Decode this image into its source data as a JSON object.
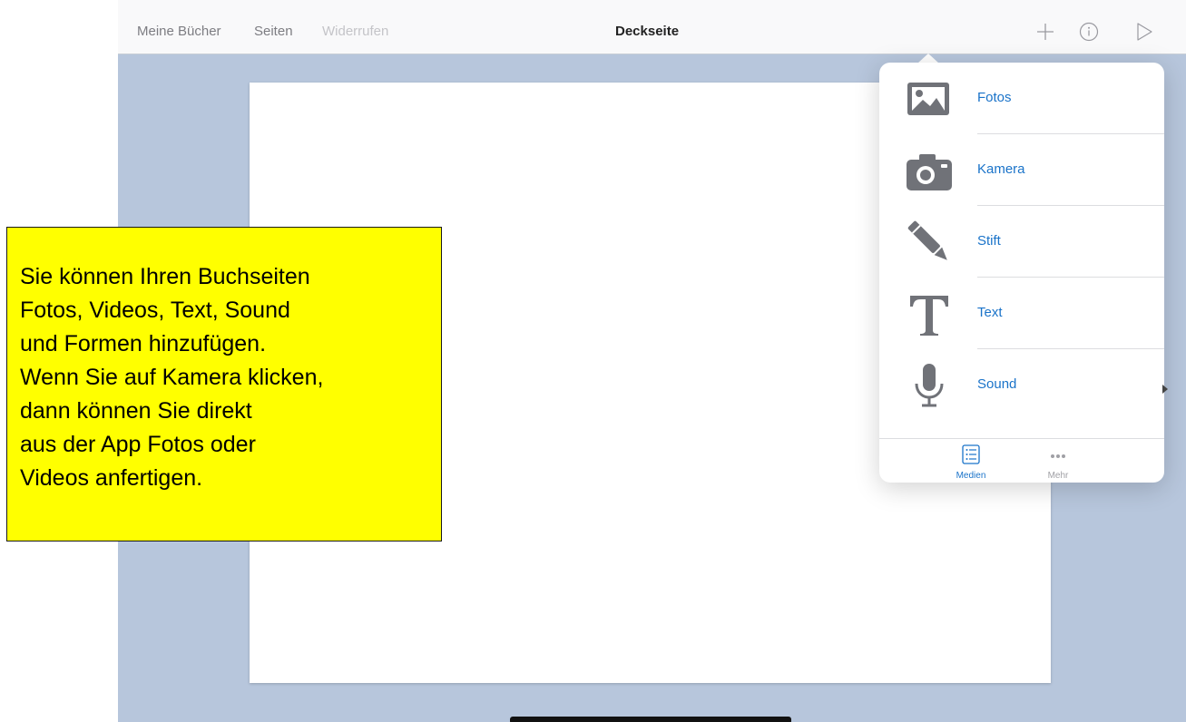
{
  "navbar": {
    "my_books": "Meine Bücher",
    "pages": "Seiten",
    "undo": "Widerrufen",
    "title": "Deckseite"
  },
  "popover": {
    "items": [
      {
        "label": "Fotos",
        "icon": "photos-icon"
      },
      {
        "label": "Kamera",
        "icon": "camera-icon"
      },
      {
        "label": "Stift",
        "icon": "pen-icon"
      },
      {
        "label": "Text",
        "icon": "text-icon"
      },
      {
        "label": "Sound",
        "icon": "microphone-icon"
      }
    ],
    "tabs": [
      {
        "label": "Medien",
        "icon": "list-icon",
        "active": true
      },
      {
        "label": "Mehr",
        "icon": "more-icon",
        "active": false
      }
    ]
  },
  "callout": {
    "lines": [
      "Sie können Ihren Buchseiten",
      "Fotos, Videos, Text, Sound",
      "und Formen hinzufügen.",
      "Wenn Sie auf Kamera klicken,",
      "dann können Sie direkt",
      "aus der App Fotos oder",
      "Videos anfertigen."
    ]
  },
  "colors": {
    "accent": "#1a73c9",
    "canvas": "#b7c6dc",
    "callout_bg": "#ffff00",
    "icon_gray": "#707278"
  }
}
